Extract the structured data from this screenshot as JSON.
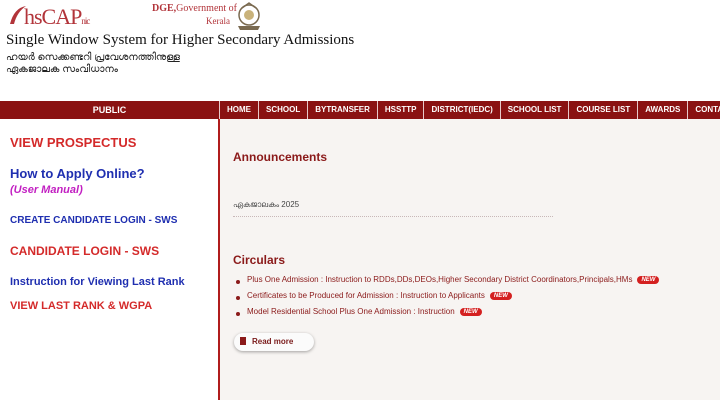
{
  "header": {
    "logo_text": "hsCAP",
    "logo_suffix": "nic",
    "dge": "DGE,",
    "govt": "Government of",
    "state": "Kerala",
    "system_title": "Single Window System for Higher Secondary Admissions",
    "malayalam_line1": "ഹയർ സെക്കണ്ടറി പ്രവേശനത്തിനുള്ള",
    "malayalam_line2": "ഏകജാലക സംവിധാനം"
  },
  "nav": {
    "public_label": "PUBLIC",
    "items": [
      "HOME",
      "SCHOOL",
      "BYTRANSFER",
      "HSSTTP",
      "DISTRICT(IEDC)",
      "SCHOOL LIST",
      "COURSE LIST",
      "AWARDS",
      "CONTACT US"
    ]
  },
  "sidebar": {
    "view_prospectus": "VIEW PROSPECTUS",
    "how_to_apply": "How to Apply Online?",
    "user_manual": "(User Manual)",
    "create_login": "CREATE CANDIDATE LOGIN - SWS",
    "candidate_login": "CANDIDATE LOGIN - SWS",
    "instruction_rank": "Instruction for Viewing Last Rank",
    "view_last_rank": "VIEW LAST RANK & WGPA"
  },
  "announcements": {
    "title": "Announcements",
    "item": "ഏകജാലകം 2025"
  },
  "circulars": {
    "title": "Circulars",
    "items": [
      "Plus One Admission : Instruction to RDDs,DDs,DEOs,Higher Secondary District Coordinators,Principals,HMs",
      "Certificates to be Produced for Admission : Instruction to Applicants",
      "Model Residential School Plus One Admission : Instruction"
    ],
    "new_badge": "NEW",
    "read_more": "Read more"
  },
  "colors": {
    "brand_red": "#8a1212",
    "sidebar_red": "#d42a2a",
    "link_blue": "#1f2fb0",
    "magenta": "#c21fc2"
  }
}
